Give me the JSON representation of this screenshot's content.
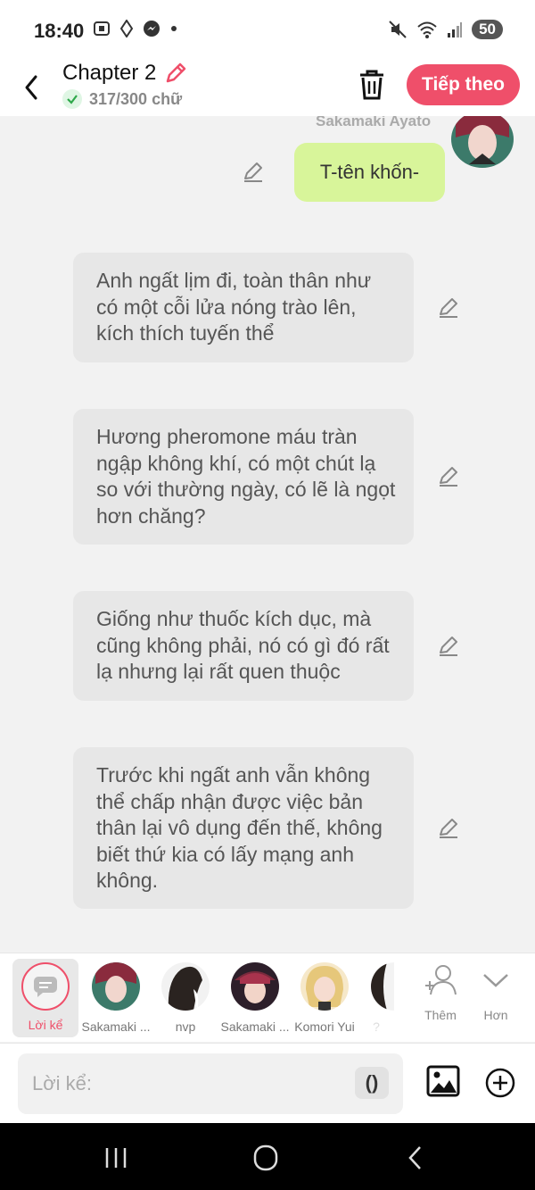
{
  "status_bar": {
    "time": "18:40",
    "battery": "50"
  },
  "header": {
    "title": "Chapter 2",
    "word_count": "317/300 chữ",
    "next_label": "Tiếp theo"
  },
  "chat": {
    "speaker_name": "Sakamaki Ayato",
    "dialogue": "T-tên khốn-",
    "narrations": [
      "Anh ngất lịm đi, toàn thân như có một cỗi lửa nóng trào lên, kích thích tuyến thể",
      "Hương pheromone máu tràn ngập không khí, có một chút lạ so với thường ngày, có lẽ là ngọt hơn chăng?",
      "Giống như thuốc kích dục, mà cũng không phải, nó có gì đó rất lạ nhưng lại rất quen thuộc",
      "Trước khi ngất anh vẫn không thể chấp nhận được việc bản thân lại vô dụng đến thế, không biết thứ kia có lấy mạng anh không."
    ]
  },
  "characters": {
    "narrator_label": "Lời kể",
    "items": [
      {
        "name": "Sakamaki ..."
      },
      {
        "name": "nvp"
      },
      {
        "name": "Sakamaki ..."
      },
      {
        "name": "Komori Yui"
      },
      {
        "name": "?"
      }
    ],
    "add_label": "Thêm",
    "more_label": "Hơn"
  },
  "input": {
    "placeholder": "Lời kể:",
    "paren_label": "()"
  },
  "colors": {
    "accent": "#ef4f6a",
    "dialogue_bubble": "#d8f59a",
    "narration_bubble": "#e7e7e7"
  }
}
